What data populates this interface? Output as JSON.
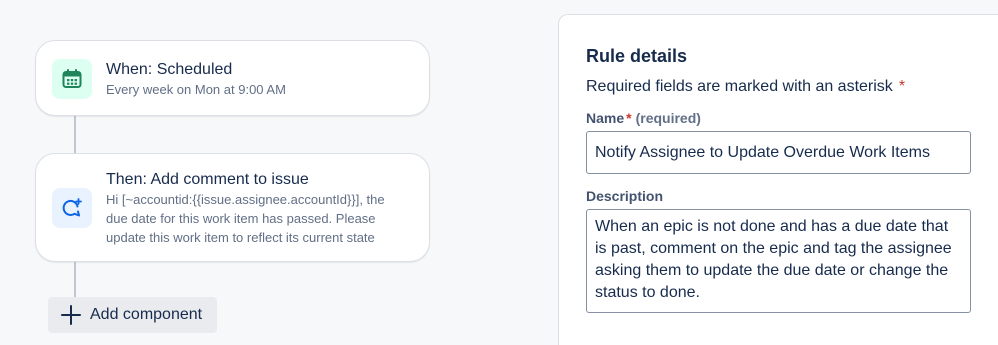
{
  "trigger": {
    "title": "When: Scheduled",
    "subtitle": "Every week on Mon at 9:00 AM",
    "icon": "calendar-icon",
    "icon_color": "#1f845a",
    "icon_bg": "#dcfff1"
  },
  "action": {
    "title": "Then: Add comment to issue",
    "subtitle_lines": [
      "Hi [~accountid:{{issue.assignee.accountId}}], the",
      "due date for this work item has passed. Please",
      "update this work item to reflect its current state"
    ],
    "icon": "comment-add-icon",
    "icon_color": "#0c66e4",
    "icon_bg": "#e9f2ff"
  },
  "add_component": {
    "label": "Add component",
    "icon": "plus-icon"
  },
  "rule_details": {
    "title": "Rule details",
    "required_note": "Required fields are marked with an asterisk",
    "asterisk": "*",
    "name_field": {
      "label": "Name",
      "required_star": "*",
      "required_hint": "(required)",
      "value": "Notify Assignee to Update Overdue Work Items"
    },
    "description_field": {
      "label": "Description",
      "value": "When an epic is not done and has a due date that is past, comment on the epic and tag the assignee asking them to update the due date or change the status to done."
    }
  },
  "colors": {
    "background": "#f7f8f9",
    "card_border": "#dcdfe4",
    "required_red": "#c9372c",
    "text_primary": "#172b4d",
    "text_subtle": "#626f86"
  }
}
